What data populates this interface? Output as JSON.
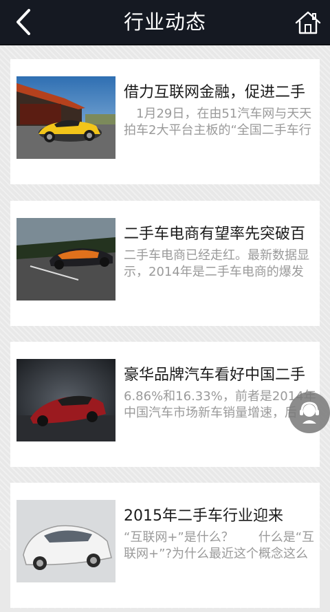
{
  "header": {
    "title": "行业动态",
    "back_icon": "chevron-left-icon",
    "home_icon": "home-icon"
  },
  "articles": [
    {
      "title": "借力互联网金融，促进二手",
      "summary": "　1月29日，在由51汽车网与天天拍车2大平台主板的“全国二手车行"
    },
    {
      "title": "二手车电商有望率先突破百",
      "summary": "二手车电商已经走红。最新数据显示，2014年是二手车电商的爆发"
    },
    {
      "title": "豪华品牌汽车看好中国二手",
      "summary": "6.86%和16.33%，前者是2014年中国汽车市场新车销量增速，后"
    },
    {
      "title": "2015年二手车行业迎来",
      "summary": "“互联网+”是什么？　　什么是“互联网+”?为什么最近这个概念这么"
    }
  ],
  "fab": {
    "icon": "customer-service-icon"
  },
  "colors": {
    "header_bg": "#151922",
    "title_text": "#1b1b1b",
    "summary_text": "#9a9a9a",
    "page_bg": "#e8e8e8"
  }
}
